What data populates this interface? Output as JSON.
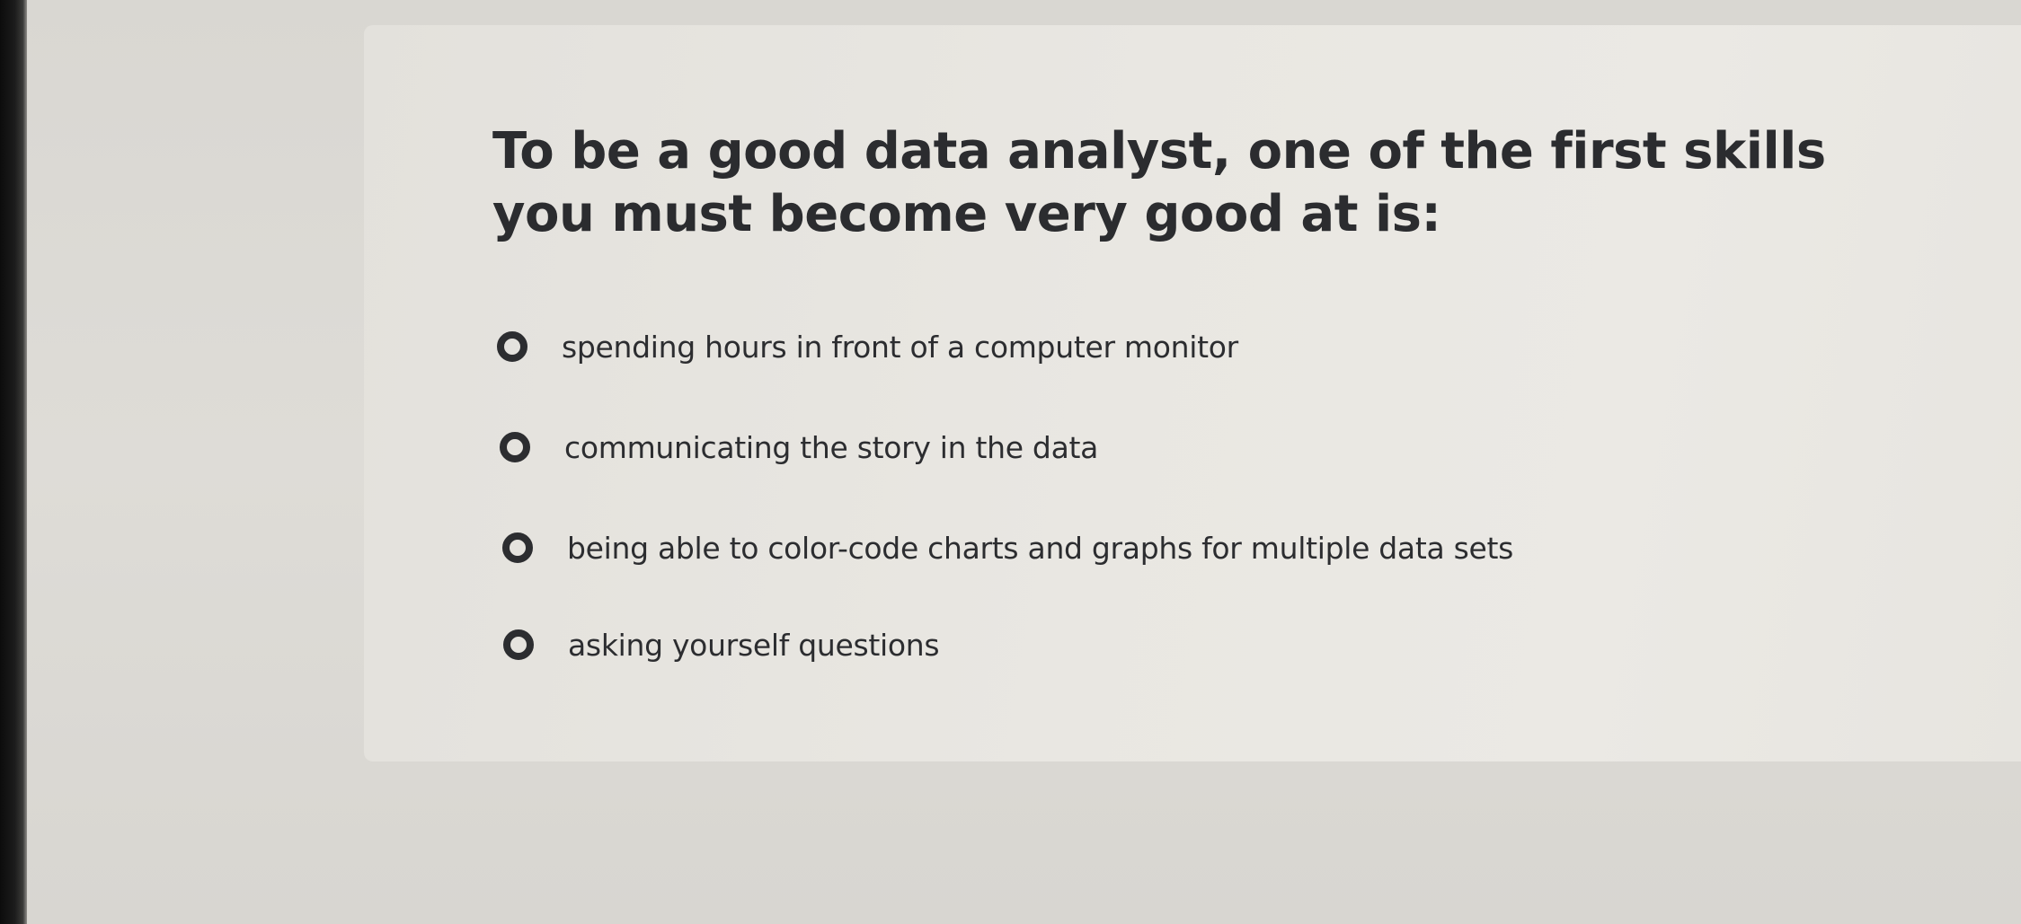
{
  "question": {
    "text": "To be a good data analyst, one of the first skills you must become very good at is:"
  },
  "options": [
    {
      "label": "spending hours in front of a computer monitor",
      "selected": false
    },
    {
      "label": "communicating the story in the data",
      "selected": false
    },
    {
      "label": "being able to color-code charts and graphs for multiple data sets",
      "selected": false
    },
    {
      "label": "asking yourself questions",
      "selected": false
    }
  ],
  "icons": {
    "radio": "radio-unselected-icon"
  },
  "colors": {
    "text": "#2b2c2f",
    "card": "#e9e7e2",
    "background": "#dcdad5"
  }
}
